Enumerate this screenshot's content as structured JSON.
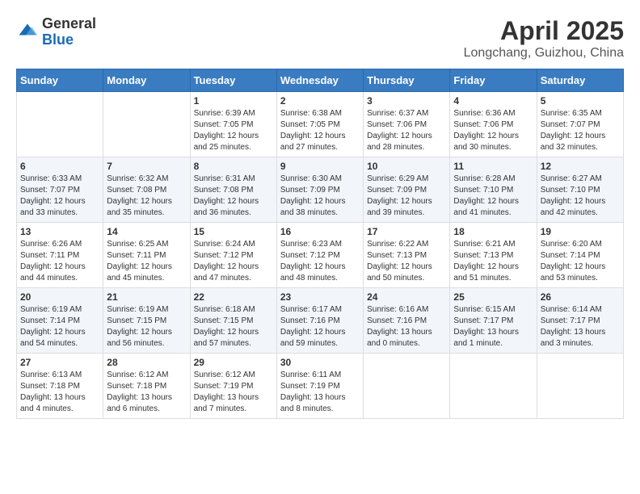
{
  "header": {
    "logo_general": "General",
    "logo_blue": "Blue",
    "main_title": "April 2025",
    "sub_title": "Longchang, Guizhou, China"
  },
  "weekdays": [
    "Sunday",
    "Monday",
    "Tuesday",
    "Wednesday",
    "Thursday",
    "Friday",
    "Saturday"
  ],
  "weeks": [
    [
      {
        "day": "",
        "empty": true
      },
      {
        "day": "",
        "empty": true
      },
      {
        "day": "1",
        "sunrise": "6:39 AM",
        "sunset": "7:05 PM",
        "daylight": "12 hours and 25 minutes."
      },
      {
        "day": "2",
        "sunrise": "6:38 AM",
        "sunset": "7:05 PM",
        "daylight": "12 hours and 27 minutes."
      },
      {
        "day": "3",
        "sunrise": "6:37 AM",
        "sunset": "7:06 PM",
        "daylight": "12 hours and 28 minutes."
      },
      {
        "day": "4",
        "sunrise": "6:36 AM",
        "sunset": "7:06 PM",
        "daylight": "12 hours and 30 minutes."
      },
      {
        "day": "5",
        "sunrise": "6:35 AM",
        "sunset": "7:07 PM",
        "daylight": "12 hours and 32 minutes."
      }
    ],
    [
      {
        "day": "6",
        "sunrise": "6:33 AM",
        "sunset": "7:07 PM",
        "daylight": "12 hours and 33 minutes."
      },
      {
        "day": "7",
        "sunrise": "6:32 AM",
        "sunset": "7:08 PM",
        "daylight": "12 hours and 35 minutes."
      },
      {
        "day": "8",
        "sunrise": "6:31 AM",
        "sunset": "7:08 PM",
        "daylight": "12 hours and 36 minutes."
      },
      {
        "day": "9",
        "sunrise": "6:30 AM",
        "sunset": "7:09 PM",
        "daylight": "12 hours and 38 minutes."
      },
      {
        "day": "10",
        "sunrise": "6:29 AM",
        "sunset": "7:09 PM",
        "daylight": "12 hours and 39 minutes."
      },
      {
        "day": "11",
        "sunrise": "6:28 AM",
        "sunset": "7:10 PM",
        "daylight": "12 hours and 41 minutes."
      },
      {
        "day": "12",
        "sunrise": "6:27 AM",
        "sunset": "7:10 PM",
        "daylight": "12 hours and 42 minutes."
      }
    ],
    [
      {
        "day": "13",
        "sunrise": "6:26 AM",
        "sunset": "7:11 PM",
        "daylight": "12 hours and 44 minutes."
      },
      {
        "day": "14",
        "sunrise": "6:25 AM",
        "sunset": "7:11 PM",
        "daylight": "12 hours and 45 minutes."
      },
      {
        "day": "15",
        "sunrise": "6:24 AM",
        "sunset": "7:12 PM",
        "daylight": "12 hours and 47 minutes."
      },
      {
        "day": "16",
        "sunrise": "6:23 AM",
        "sunset": "7:12 PM",
        "daylight": "12 hours and 48 minutes."
      },
      {
        "day": "17",
        "sunrise": "6:22 AM",
        "sunset": "7:13 PM",
        "daylight": "12 hours and 50 minutes."
      },
      {
        "day": "18",
        "sunrise": "6:21 AM",
        "sunset": "7:13 PM",
        "daylight": "12 hours and 51 minutes."
      },
      {
        "day": "19",
        "sunrise": "6:20 AM",
        "sunset": "7:14 PM",
        "daylight": "12 hours and 53 minutes."
      }
    ],
    [
      {
        "day": "20",
        "sunrise": "6:19 AM",
        "sunset": "7:14 PM",
        "daylight": "12 hours and 54 minutes."
      },
      {
        "day": "21",
        "sunrise": "6:19 AM",
        "sunset": "7:15 PM",
        "daylight": "12 hours and 56 minutes."
      },
      {
        "day": "22",
        "sunrise": "6:18 AM",
        "sunset": "7:15 PM",
        "daylight": "12 hours and 57 minutes."
      },
      {
        "day": "23",
        "sunrise": "6:17 AM",
        "sunset": "7:16 PM",
        "daylight": "12 hours and 59 minutes."
      },
      {
        "day": "24",
        "sunrise": "6:16 AM",
        "sunset": "7:16 PM",
        "daylight": "13 hours and 0 minutes."
      },
      {
        "day": "25",
        "sunrise": "6:15 AM",
        "sunset": "7:17 PM",
        "daylight": "13 hours and 1 minute."
      },
      {
        "day": "26",
        "sunrise": "6:14 AM",
        "sunset": "7:17 PM",
        "daylight": "13 hours and 3 minutes."
      }
    ],
    [
      {
        "day": "27",
        "sunrise": "6:13 AM",
        "sunset": "7:18 PM",
        "daylight": "13 hours and 4 minutes."
      },
      {
        "day": "28",
        "sunrise": "6:12 AM",
        "sunset": "7:18 PM",
        "daylight": "13 hours and 6 minutes."
      },
      {
        "day": "29",
        "sunrise": "6:12 AM",
        "sunset": "7:19 PM",
        "daylight": "13 hours and 7 minutes."
      },
      {
        "day": "30",
        "sunrise": "6:11 AM",
        "sunset": "7:19 PM",
        "daylight": "13 hours and 8 minutes."
      },
      {
        "day": "",
        "empty": true
      },
      {
        "day": "",
        "empty": true
      },
      {
        "day": "",
        "empty": true
      }
    ]
  ],
  "labels": {
    "sunrise": "Sunrise:",
    "sunset": "Sunset:",
    "daylight": "Daylight:"
  }
}
